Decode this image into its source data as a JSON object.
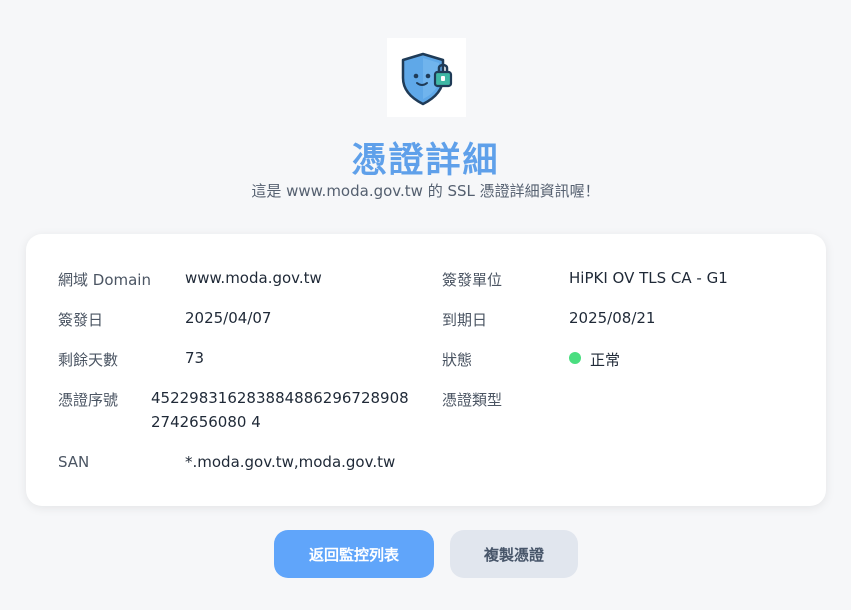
{
  "header": {
    "logo_icon": "shield-lock-icon",
    "title": "憑證詳細",
    "subtitle": "這是 www.moda.gov.tw 的 SSL 憑證詳細資訊喔！"
  },
  "details": {
    "domain_label": "網域 Domain",
    "domain_value": "www.moda.gov.tw",
    "issuer_label": "簽發單位",
    "issuer_value": "HiPKI OV TLS CA - G1",
    "issued_label": "簽發日",
    "issued_value": "2025/04/07",
    "expiry_label": "到期日",
    "expiry_value": "2025/08/21",
    "days_label": "剩餘天數",
    "days_value": "73",
    "status_label": "狀態",
    "status_value": "正常",
    "status_color": "#4ade80",
    "serial_label": "憑證序號",
    "serial_value": "4522983162838848862967289082742656080 4",
    "type_label": "憑證類型",
    "type_value": "",
    "san_label": "SAN",
    "san_value": "*.moda.gov.tw,moda.gov.tw"
  },
  "actions": {
    "back_label": "返回監控列表",
    "copy_label": "複製憑證"
  },
  "colors": {
    "accent": "#5fa0ea",
    "primary_button": "#60a5fa",
    "secondary_button": "#e1e6ee"
  }
}
